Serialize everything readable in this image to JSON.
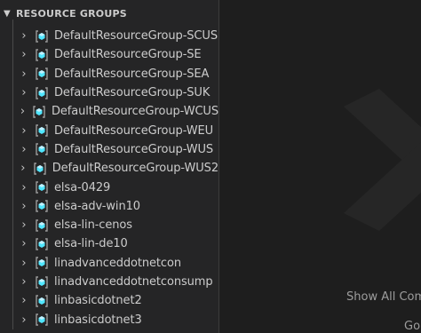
{
  "section": {
    "title": "RESOURCE GROUPS",
    "chevron_icon": "chevron-down-icon"
  },
  "resource_groups": [
    {
      "label": "DefaultResourceGroup-SCUS"
    },
    {
      "label": "DefaultResourceGroup-SE"
    },
    {
      "label": "DefaultResourceGroup-SEA"
    },
    {
      "label": "DefaultResourceGroup-SUK"
    },
    {
      "label": "DefaultResourceGroup-WCUS"
    },
    {
      "label": "DefaultResourceGroup-WEU"
    },
    {
      "label": "DefaultResourceGroup-WUS"
    },
    {
      "label": "DefaultResourceGroup-WUS2"
    },
    {
      "label": "elsa-0429"
    },
    {
      "label": "elsa-adv-win10"
    },
    {
      "label": "elsa-lin-cenos"
    },
    {
      "label": "elsa-lin-de10"
    },
    {
      "label": "linadvanceddotnetcon"
    },
    {
      "label": "linadvanceddotnetconsump"
    },
    {
      "label": "linbasicdotnet2"
    },
    {
      "label": "linbasicdotnet3"
    }
  ],
  "editor": {
    "hint_show_all": "Show All Com",
    "hint_go": "Go"
  },
  "colors": {
    "sidebar_bg": "#252526",
    "editor_bg": "#1e1e1e",
    "text": "#cccccc",
    "icon_accent": "#50e6ff"
  }
}
